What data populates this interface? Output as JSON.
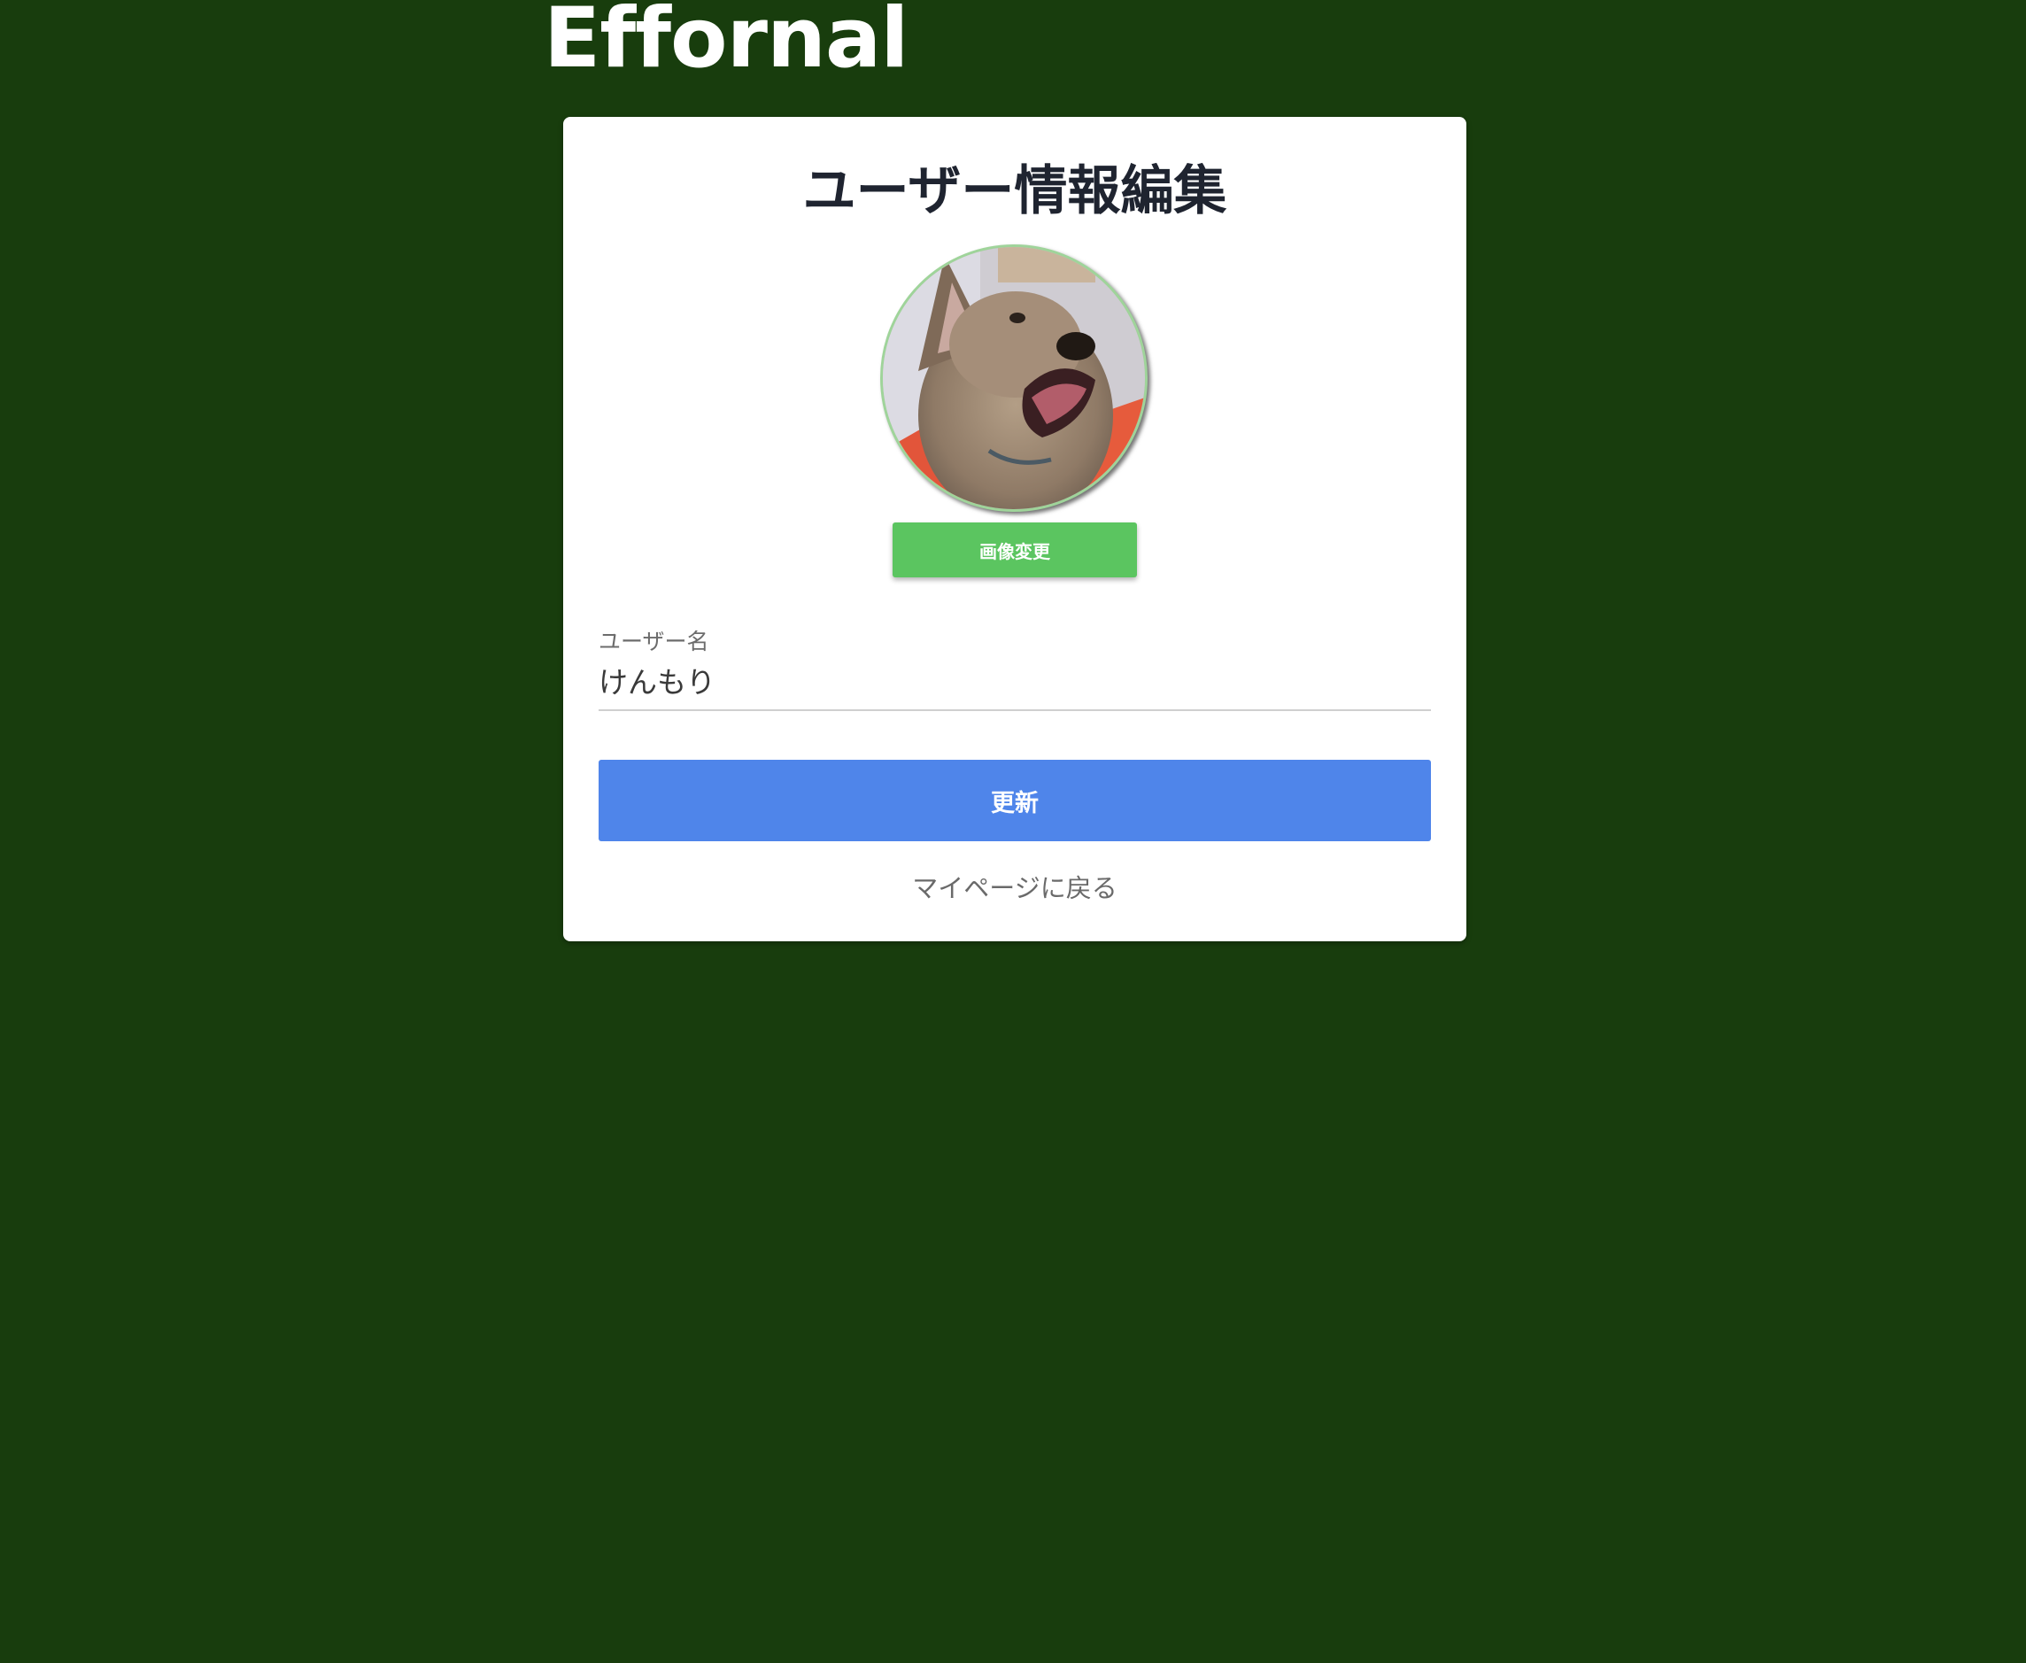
{
  "header": {
    "app_title": "Effornal"
  },
  "card": {
    "title": "ユーザー情報編集",
    "avatar_alt": "dog-photo",
    "change_image_label": "画像変更",
    "username_label": "ユーザー名",
    "username_value": "けんもり",
    "update_label": "更新",
    "back_link_label": "マイページに戻る"
  },
  "colors": {
    "background": "#183d0d",
    "change_image_button": "#5bc560",
    "update_button": "#4f85ea"
  }
}
